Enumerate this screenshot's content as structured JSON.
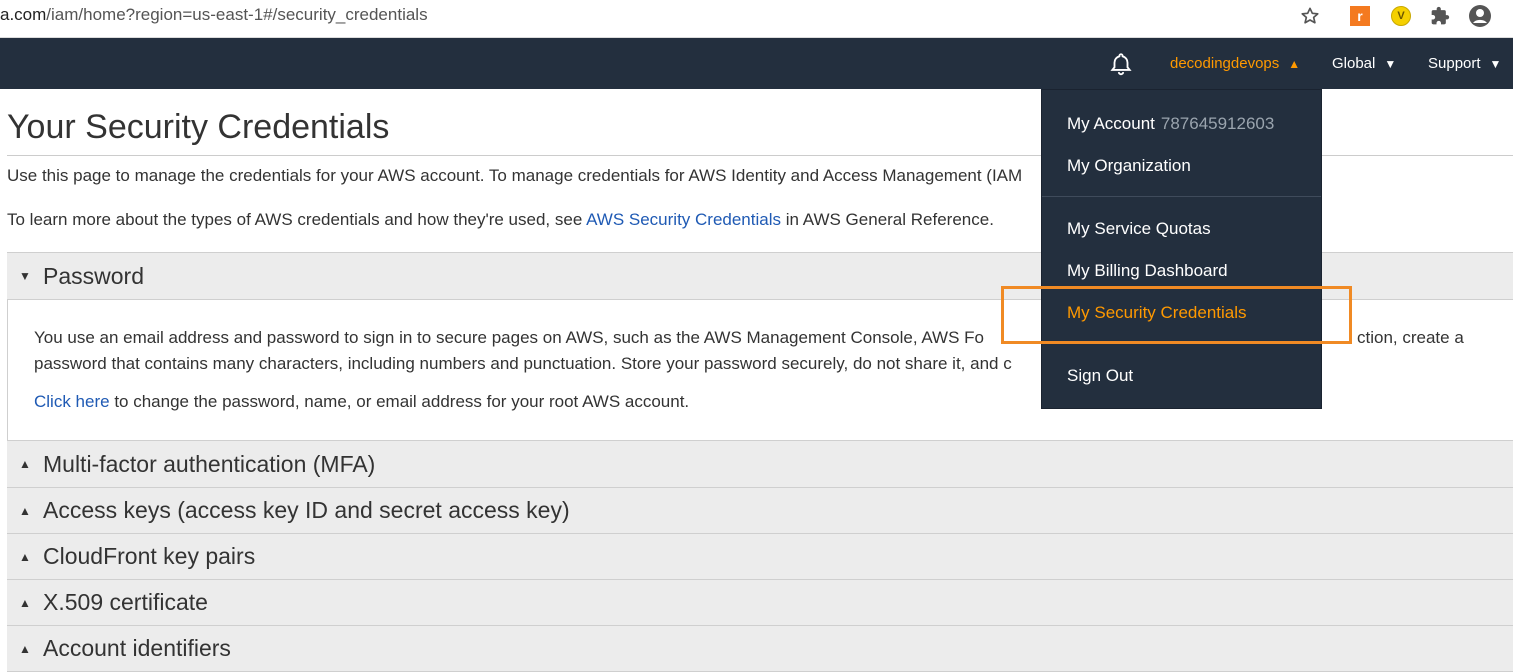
{
  "browser": {
    "url_domain": "a.com",
    "url_path": "/iam/home?region=us-east-1#/security_credentials",
    "extension_orange_label": "r",
    "extension_yellow_label": "V"
  },
  "navbar": {
    "username": "decodingdevops",
    "region": "Global",
    "support": "Support"
  },
  "page": {
    "title": "Your Security Credentials",
    "intro1": "Use this page to manage the credentials for your AWS account. To manage credentials for AWS Identity and Access Management (IAM",
    "intro2_pre": "To learn more about the types of AWS credentials and how they're used, see ",
    "intro2_link": "AWS Security Credentials",
    "intro2_post": " in AWS General Reference."
  },
  "sections": {
    "password": {
      "label": "Password",
      "line1": "You use an email address and password to sign in to secure pages on AWS, such as the AWS Management Console, AWS Fo",
      "line1_tail": "ction, create a",
      "line2": "password that contains many characters, including numbers and punctuation. Store your password securely, do not share it, and c",
      "line3_link": "Click here",
      "line3_rest": " to change the password, name, or email address for your root AWS account."
    },
    "mfa": "Multi-factor authentication (MFA)",
    "access_keys": "Access keys (access key ID and secret access key)",
    "cloudfront": "CloudFront key pairs",
    "x509": "X.509 certificate",
    "account_ids": "Account identifiers"
  },
  "dropdown": {
    "my_account": "My Account",
    "account_number": "787645912603",
    "my_organization": "My Organization",
    "service_quotas": "My Service Quotas",
    "billing": "My Billing Dashboard",
    "security_credentials": "My Security Credentials",
    "sign_out": "Sign Out"
  },
  "colors": {
    "nav_bg": "#232f3e",
    "accent_orange": "#ff9900",
    "link_blue": "#1f5ab4",
    "highlight_box": "#f08a24"
  }
}
